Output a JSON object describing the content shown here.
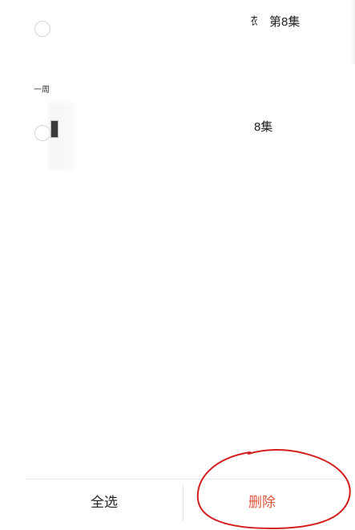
{
  "items": [
    {
      "title_fragment": "衣",
      "title": "第8集"
    },
    {
      "title": "8集"
    }
  ],
  "section": {
    "label": "一周"
  },
  "bottom_bar": {
    "select_all_label": "全选",
    "delete_label": "删除"
  },
  "colors": {
    "delete_text": "#e0563f",
    "annotation_circle": "#d51d1d"
  }
}
